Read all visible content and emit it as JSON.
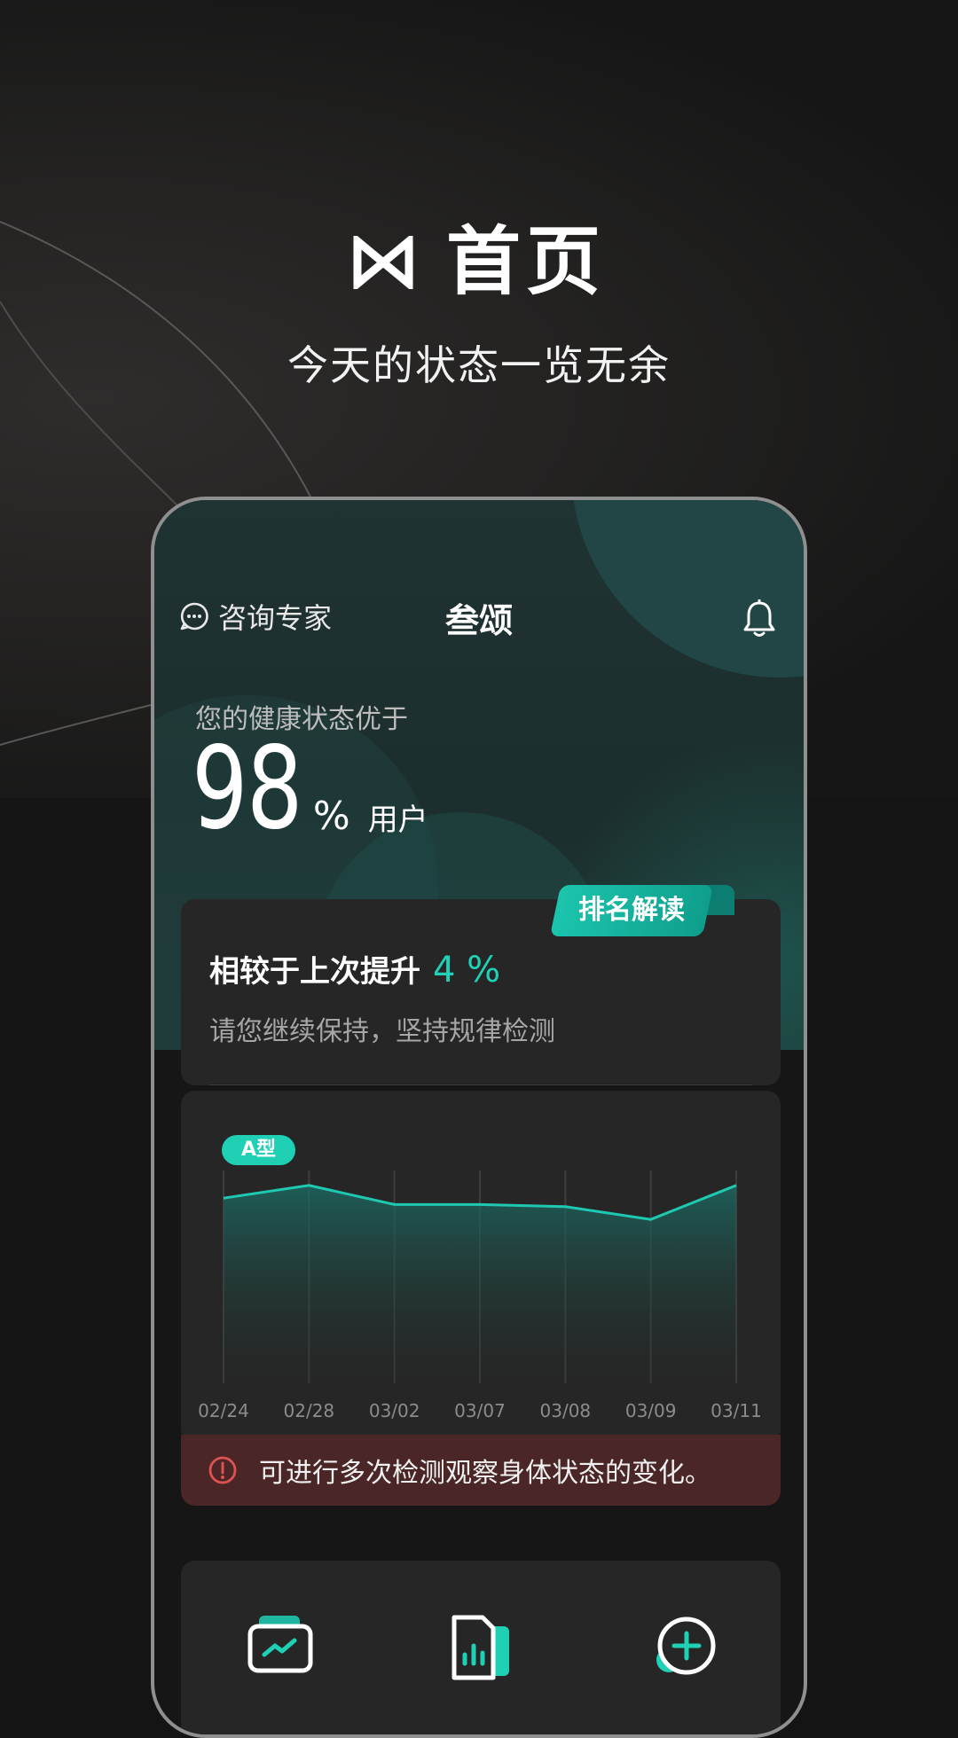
{
  "hero": {
    "title": "首页",
    "subtitle": "今天的状态一览无余"
  },
  "header": {
    "consult_label": "咨询专家",
    "app_title": "叁颂"
  },
  "health": {
    "label": "您的健康状态优于",
    "value": "98",
    "percent_sign": "%",
    "unit": "用户"
  },
  "ranking_card": {
    "tag": "排名解读",
    "title": "相较于上次提升",
    "improvement": "4 %",
    "subtitle": "请您继续保持，坚持规律检测"
  },
  "chart_card": {
    "type_badge": "A型"
  },
  "chart_data": {
    "type": "area",
    "categories": [
      "02/24",
      "02/28",
      "03/02",
      "03/07",
      "03/08",
      "03/09",
      "03/11"
    ],
    "values": [
      87,
      93,
      84,
      84,
      83,
      77,
      93
    ],
    "ylim": [
      0,
      100
    ],
    "grid": "vertical",
    "color": "#1fc8b0"
  },
  "warning": {
    "text": "可进行多次检测观察身体状态的变化。",
    "color": "#e05252"
  },
  "colors": {
    "accent": "#1fd0b5",
    "background": "#141414",
    "card": "#262626",
    "warning_bg": "#4b2626"
  },
  "icons": {
    "header_left": "chat-bubble-icon",
    "header_right": "bell-icon",
    "nav": [
      "trend-card-icon",
      "report-icon",
      "add-circle-icon"
    ]
  }
}
